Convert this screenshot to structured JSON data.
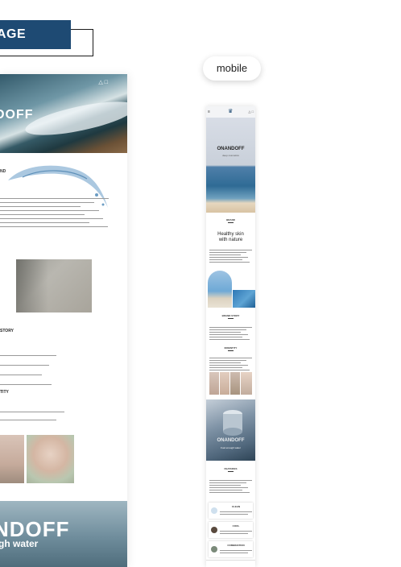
{
  "label": {
    "text": "AGE"
  },
  "mobile_pill": {
    "label": "mobile"
  },
  "desktop": {
    "brand": "DOFF",
    "section_brand": "ND",
    "section_story": "STORY",
    "section_identity": "TITY",
    "bottom_brand": "NDOFF",
    "bottom_sub": "gh water"
  },
  "mobile": {
    "hero_title": "ONANDOFF",
    "hero_sub": "deep cosmetics",
    "brand_label": "BRAND",
    "healthy_line1": "Healthy skin",
    "healthy_line2": "with nature",
    "brand_story_label": "BRAND STORY",
    "identity_label": "INDENTITY",
    "product_title": "ONANDOFF",
    "product_sub": "Fuel enough water",
    "features_label": "FEATURES",
    "cards": [
      {
        "title": "CLEAN"
      },
      {
        "title": "COOL"
      },
      {
        "title": "COMBINATION"
      }
    ]
  },
  "colors": {
    "accent": "#1e4a73",
    "background": "#ffffff"
  }
}
